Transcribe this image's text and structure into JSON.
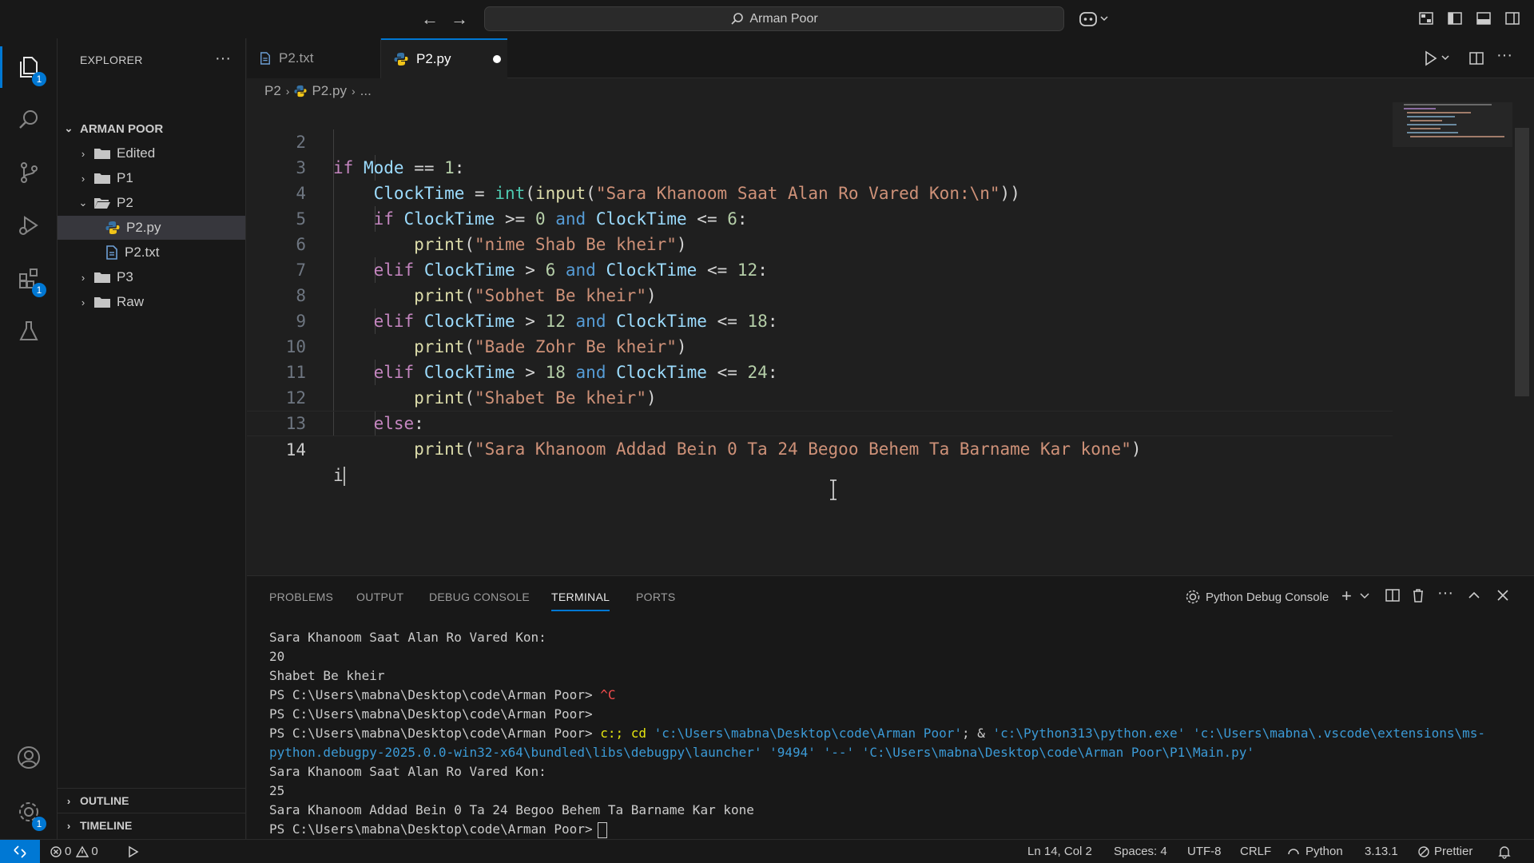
{
  "titlebar": {
    "search_text": "Arman Poor"
  },
  "activity": {
    "explorer_badge": "1",
    "extensions_badge": "1",
    "settings_badge": "1"
  },
  "sidebar": {
    "title": "EXPLORER",
    "root": "ARMAN POOR",
    "items": [
      "Edited",
      "P1",
      "P2",
      "P2.py",
      "P2.txt",
      "P3",
      "Raw"
    ],
    "outline": "OUTLINE",
    "timeline": "TIMELINE"
  },
  "tabs": [
    {
      "label": "P2.txt",
      "active": false
    },
    {
      "label": "P2.py",
      "active": true,
      "dirty": true
    }
  ],
  "breadcrumb": {
    "folder": "P2",
    "file": "P2.py",
    "more": "..."
  },
  "editor": {
    "line_numbers": [
      "2",
      "3",
      "4",
      "5",
      "6",
      "7",
      "8",
      "9",
      "10",
      "11",
      "12",
      "13",
      "14"
    ],
    "active_line": "14",
    "cursor_text": "i"
  },
  "panel": {
    "tabs": [
      "PROBLEMS",
      "OUTPUT",
      "DEBUG CONSOLE",
      "TERMINAL",
      "PORTS"
    ],
    "active_tab": "TERMINAL",
    "terminal_name": "Python Debug Console",
    "lines": {
      "l1": "Sara Khanoom Saat Alan Ro Vared Kon:",
      "l2": "20",
      "l3": "Shabet Be kheir",
      "l4_prompt": "PS C:\\Users\\mabna\\Desktop\\code\\Arman Poor> ",
      "l4_ctrlc": "^C",
      "l5": "PS C:\\Users\\mabna\\Desktop\\code\\Arman Poor>",
      "l6_prompt": "PS C:\\Users\\mabna\\Desktop\\code\\Arman Poor> ",
      "l6_cmd1": "c:; cd ",
      "l6_path1": "'c:\\Users\\mabna\\Desktop\\code\\Arman Poor'",
      "l6_amp": "; & ",
      "l6_path2": "'c:\\Python313\\python.exe' 'c:\\Users\\mabna\\.vscode\\extensions\\ms-",
      "l7": "python.debugpy-2025.0.0-win32-x64\\bundled\\libs\\debugpy\\launcher' '9494' '--' 'C:\\Users\\mabna\\Desktop\\code\\Arman Poor\\P1\\Main.py'",
      "l8": "Sara Khanoom Saat Alan Ro Vared Kon:",
      "l9": "25",
      "l10": "Sara Khanoom Addad Bein 0 Ta 24 Begoo Behem Ta Barname Kar kone",
      "l11": "PS C:\\Users\\mabna\\Desktop\\code\\Arman Poor>"
    }
  },
  "status": {
    "errors": "0",
    "warnings": "0",
    "position": "Ln 14, Col 2",
    "spaces": "Spaces: 4",
    "encoding": "UTF-8",
    "eol": "CRLF",
    "language": "Python",
    "version": "3.13.1",
    "prettier": "Prettier"
  },
  "colors": {
    "accent": "#0078d4",
    "editor_bg": "#1f1f1f",
    "chrome_bg": "#181818"
  }
}
